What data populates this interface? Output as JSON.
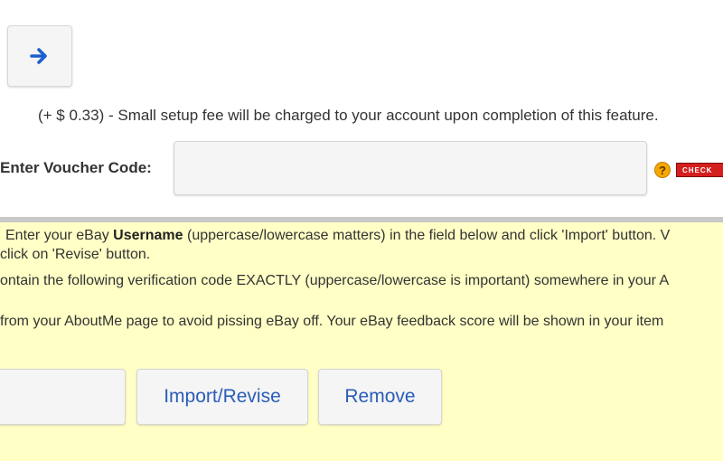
{
  "arrow_button": {
    "icon": "arrow-right-icon"
  },
  "fee": {
    "amount": "(+ $ 0.33)",
    "dash": " - ",
    "text": "Small setup fee will be charged to your account upon completion of this feature."
  },
  "voucher": {
    "label": "Enter Voucher Code:",
    "value": "",
    "help_icon": "?",
    "check_label": "CHECK"
  },
  "instructions": {
    "line1_pre": "Enter your eBay ",
    "line1_bold": "Username",
    "line1_post": " (uppercase/lowercase matters) in the field below and click 'Import' button. V",
    "line2": "click on 'Revise' button.",
    "line3": "ontain the following verification code EXACTLY (uppercase/lowercase is important) somewhere in your A",
    "line4": "from your AboutMe page to avoid pissing eBay off. Your eBay feedback score will be shown in your item"
  },
  "buttons": {
    "import_revise": "Import/Revise",
    "remove": "Remove"
  },
  "colors": {
    "panel_bg": "#ffffc6",
    "link_blue": "#2a5db8",
    "check_red": "#d51f1f",
    "help_orange": "#f5a800"
  }
}
